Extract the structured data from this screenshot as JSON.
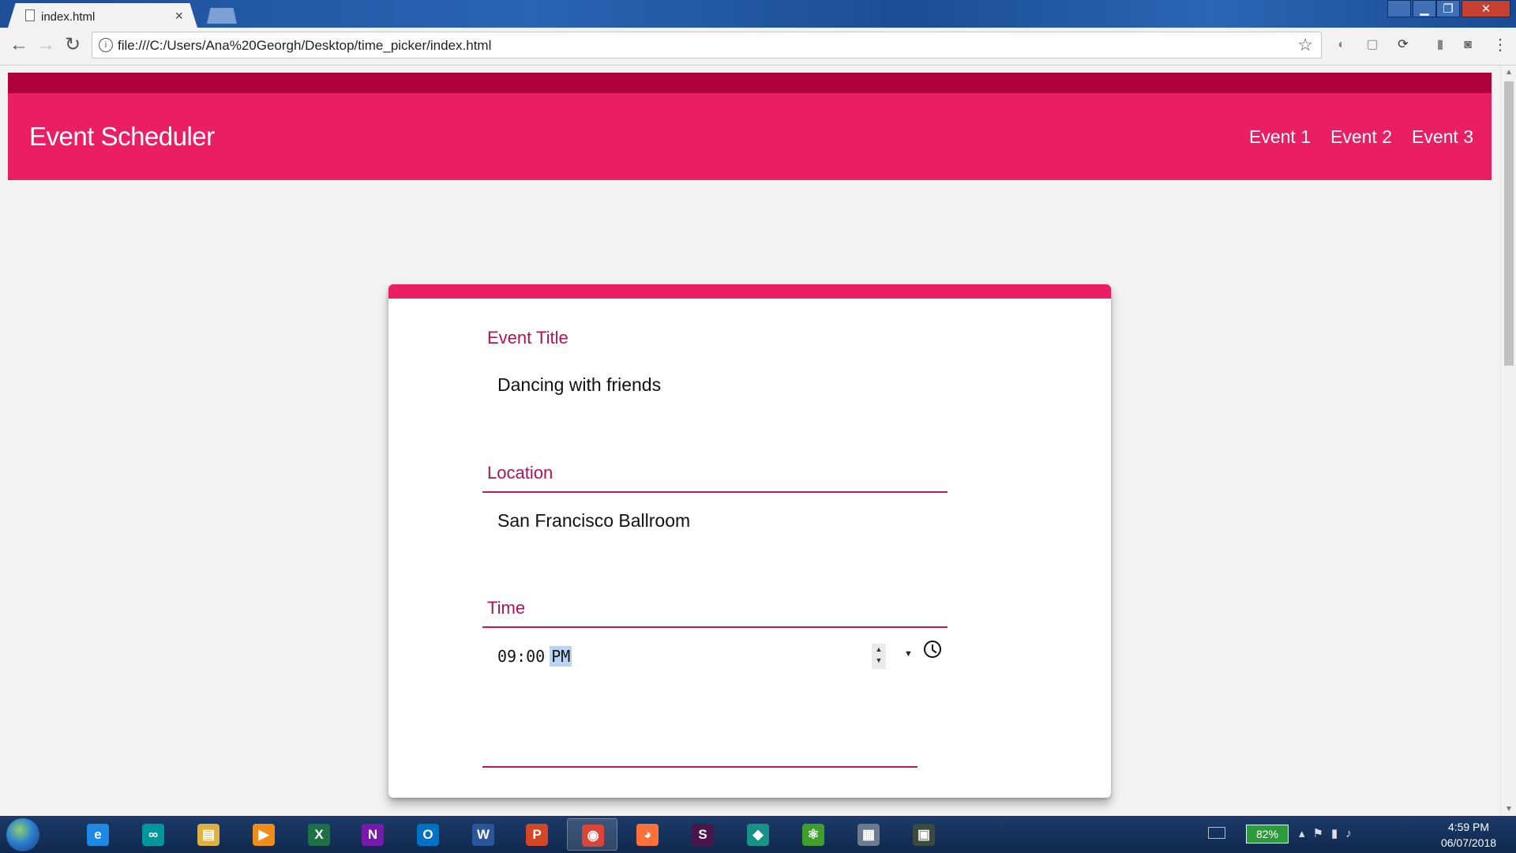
{
  "browser": {
    "tab_title": "index.html",
    "tab_close": "×",
    "url": "file:///C:/Users/Ana%20Georgh/Desktop/time_picker/index.html",
    "back": "←",
    "forward": "→",
    "reload": "↻",
    "info": "i",
    "star": "☆",
    "menu": "⋮",
    "window_controls": {
      "minimize": "▁",
      "maximize": "❐",
      "close": "✕",
      "user": "👤"
    }
  },
  "page": {
    "brand": "Event Scheduler",
    "nav": [
      "Event 1",
      "Event 2",
      "Event 3"
    ],
    "accent_color": "#e91e63",
    "accent_dark": "#b0003a",
    "form": {
      "title_label": "Event Title",
      "title_value": "Dancing with friends",
      "location_label": "Location",
      "location_value": "San Francisco Ballroom",
      "time_label": "Time",
      "time_value": "09:00",
      "time_ampm": "PM",
      "stepper": "▲\n▼",
      "dropdown": "▼"
    }
  },
  "taskbar": {
    "apps": [
      {
        "name": "internet-explorer",
        "glyph": "e",
        "color": "#1e88e5"
      },
      {
        "name": "arduino",
        "glyph": "∞",
        "color": "#00979c"
      },
      {
        "name": "file-explorer",
        "glyph": "▤",
        "color": "#e0b040"
      },
      {
        "name": "media-player",
        "glyph": "▶",
        "color": "#f08c1a"
      },
      {
        "name": "excel",
        "glyph": "X",
        "color": "#1e7145"
      },
      {
        "name": "onenote",
        "glyph": "N",
        "color": "#7719aa"
      },
      {
        "name": "outlook",
        "glyph": "O",
        "color": "#0072c6"
      },
      {
        "name": "word",
        "glyph": "W",
        "color": "#2b579a"
      },
      {
        "name": "powerpoint",
        "glyph": "P",
        "color": "#d24726"
      },
      {
        "name": "chrome",
        "glyph": "◉",
        "color": "#db4437"
      },
      {
        "name": "firefox",
        "glyph": "◕",
        "color": "#ff7139"
      },
      {
        "name": "slack",
        "glyph": "S",
        "color": "#4a154b"
      },
      {
        "name": "gitkraken",
        "glyph": "◆",
        "color": "#179287"
      },
      {
        "name": "atom",
        "glyph": "⚛",
        "color": "#40a02b"
      },
      {
        "name": "calculator",
        "glyph": "▦",
        "color": "#6b7a8f"
      },
      {
        "name": "terminal",
        "glyph": "▣",
        "color": "#3c4a3c"
      }
    ],
    "battery": "82%",
    "time": "4:59 PM",
    "date": "06/07/2018"
  }
}
